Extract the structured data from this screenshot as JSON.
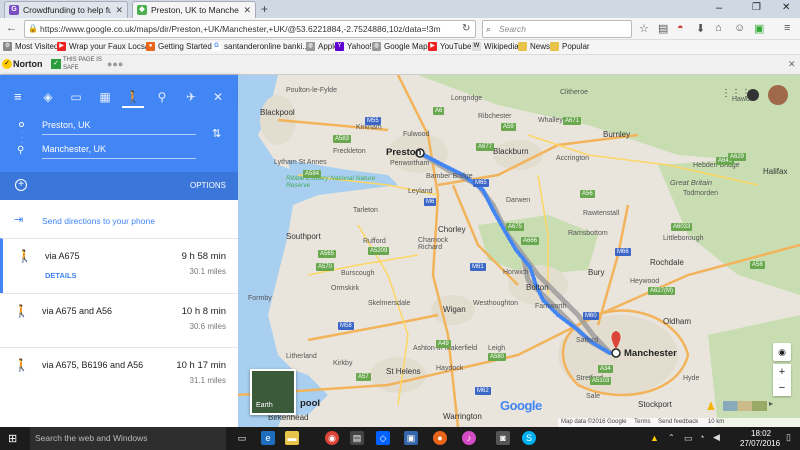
{
  "browser": {
    "tabs": [
      {
        "title": "Crowdfunding to help fun...",
        "active": false
      },
      {
        "title": "Preston, UK to Manchester...",
        "active": true
      }
    ],
    "new_tab": "+",
    "url": "https://www.google.co.uk/maps/dir/Preston,+UK/Manchester,+UK/@53.6221884,-2.7524886,10z/data=!3m",
    "search_placeholder": "Search",
    "bookmarks": [
      "Most Visited",
      "Wrap your Faux Locs/...",
      "Getting Started",
      "santanderonline banki...",
      "Apple",
      "Yahoo!",
      "Google Maps",
      "YouTube",
      "Wikipedia",
      "News",
      "Popular"
    ],
    "norton": {
      "brand": "Norton",
      "status_line1": "THIS PAGE IS",
      "status_line2": "SAFE"
    },
    "window_controls": [
      "–",
      "❐",
      "✕"
    ]
  },
  "directions": {
    "origin": "Preston, UK",
    "destination": "Manchester, UK",
    "options_label": "OPTIONS",
    "send_label": "Send directions to your phone",
    "routes": [
      {
        "via": "via A675",
        "duration": "9 h 58 min",
        "distance": "30.1 miles",
        "details": "DETAILS"
      },
      {
        "via": "via A675 and A56",
        "duration": "10 h 8 min",
        "distance": "30.6 miles"
      },
      {
        "via": "via A675, B6196 and A56",
        "duration": "10 h 17 min",
        "distance": "31.1 miles"
      }
    ]
  },
  "map": {
    "places": {
      "preston": "Preston",
      "manchester": "Manchester",
      "blackpool": "Blackpool",
      "southport": "Southport",
      "blackburn": "Blackburn",
      "burnley": "Burnley",
      "bolton": "Bolton",
      "wigan": "Wigan",
      "bury": "Bury",
      "rochdale": "Rochdale",
      "oldham": "Oldham",
      "st_helens": "St Helens",
      "warrington": "Warrington",
      "stockport": "Stockport",
      "stretford": "Stretford",
      "halifax": "Halifax",
      "accrington": "Accrington",
      "chorley": "Chorley",
      "leyland": "Leyland",
      "fulwood": "Fulwood",
      "ormskirk": "Ormskirk",
      "skelmersdale": "Skelmersdale",
      "formby": "Formby",
      "lytham": "Lytham St Annes",
      "poulton": "Poulton-le-Fylde",
      "great_britain": "Great Britain",
      "ribble_estuary": "Ribble Estuary National Nature Reserve",
      "birkenhead": "Birkenhead",
      "pool": "pool",
      "earth": "Earth",
      "google": "Google",
      "clitheroe": "Clitheroe",
      "longridge": "Longridge",
      "ribchester": "Ribchester",
      "whalley": "Whalley",
      "rawtenstall": "Rawtenstall",
      "ramsbottom": "Ramsbottom",
      "darwen": "Darwen",
      "horwich": "Horwich",
      "farnworth": "Farnworth",
      "westhoughton": "Westhoughton",
      "leigh": "Leigh",
      "ashton": "Ashton-in-Makerfield",
      "haydock": "Haydock",
      "salford": "Salford",
      "sale": "Sale",
      "altrincham": "Altrincham",
      "hyde": "Hyde",
      "stalybridge": "Stalybridge",
      "littleborough": "Littleborough",
      "todmorden": "Todmorden",
      "hebden_bridge": "Hebden Bridge",
      "bamber_bridge": "Bamber Bridge",
      "penwortham": "Penwortham",
      "tarleton": "Tarleton",
      "rufford": "Rufford",
      "burscough": "Burscough",
      "charnock": "Charnock Richard",
      "prescot": "Prescot",
      "widnes": "Widnes",
      "huyton": "Huyton",
      "kirkby": "Kirkby",
      "litherland": "Litherland",
      "crosby": "Crosby",
      "freckleton": "Freckleton",
      "kirkham": "Kirkham",
      "hawort": "Hawort",
      "walkden": "Walkden",
      "swinton": "Swinton",
      "radcliffe": "Radcliffe",
      "heywood": "Heywood",
      "middleton": "Middleton",
      "ashton_ul": "Ashton-under-Lyne"
    },
    "road_badges": [
      "M55",
      "M6",
      "M65",
      "M61",
      "M62",
      "M58",
      "M60",
      "M66",
      "A59",
      "A565",
      "A570",
      "A666",
      "A675",
      "A56",
      "A6",
      "A583",
      "A584",
      "A671",
      "A677",
      "A646",
      "A629",
      "A58",
      "A57",
      "A49",
      "A5209",
      "A6033",
      "A627(M)",
      "A580",
      "A34",
      "A5103"
    ],
    "footer": {
      "map_data": "Map data ©2016 Google",
      "terms": "Terms",
      "feedback": "Send feedback",
      "scale": "10 km"
    },
    "zoom_in": "+",
    "zoom_out": "−"
  },
  "taskbar": {
    "search_placeholder": "Search the web and Windows",
    "time": "18:02",
    "date": "27/07/2016"
  }
}
